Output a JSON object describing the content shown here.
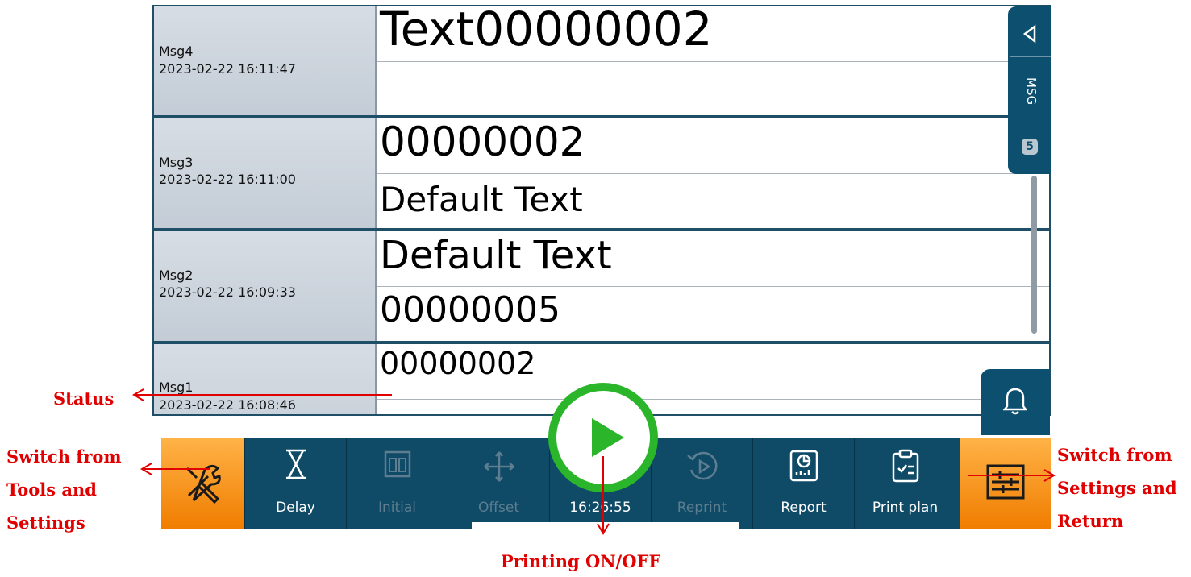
{
  "messages": [
    {
      "name": "Msg4",
      "date": "2023-02-22 16:11:47",
      "line1": "Text00000002",
      "line2": ""
    },
    {
      "name": "Msg3",
      "date": "2023-02-22 16:11:00",
      "line1": "00000002",
      "line2": "Default Text"
    },
    {
      "name": "Msg2",
      "date": "2023-02-22 16:09:33",
      "line1": "Default Text",
      "line2": "00000005"
    },
    {
      "name": "Msg1",
      "date": "2023-02-22 16:08:46",
      "line1": "00000002",
      "line2": ""
    }
  ],
  "msg_tab": {
    "label": "MSG",
    "count": "5"
  },
  "toolbar": {
    "delay": "Delay",
    "initial": "Initial",
    "offset": "Offset",
    "time": "16:26:55",
    "reprint": "Reprint",
    "report": "Report",
    "print_plan": "Print plan"
  },
  "annotations": {
    "status": "Status",
    "switch_tools": "Switch from Tools and Settings",
    "switch_settings": "Switch from Settings and Return",
    "printing": "Printing ON/OFF"
  },
  "colors": {
    "panel": "#0f4a67",
    "accent_orange": "#f07d00",
    "play_green": "#2ab52a",
    "annotation_red": "#e00000"
  }
}
